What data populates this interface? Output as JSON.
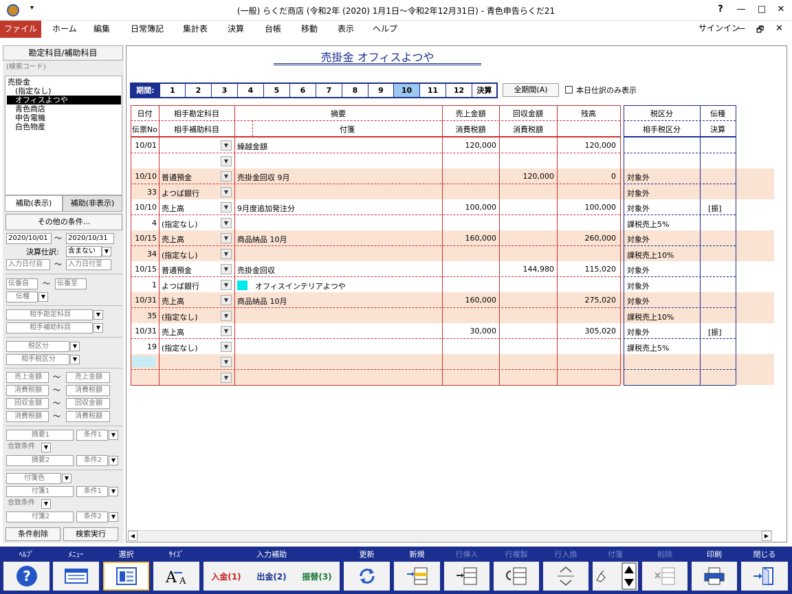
{
  "window": {
    "title": "(一般) らくだ商店 (令和2年 (2020) 1月1日～令和2年12月31日) - 青色申告らくだ21",
    "help": "?",
    "min": "—",
    "max": "□",
    "close": "✕"
  },
  "menu": {
    "items": [
      "ファイル",
      "ホーム",
      "編集",
      "日常簿記",
      "集計表",
      "決算",
      "台帳",
      "移動",
      "表示",
      "ヘルプ"
    ],
    "signin": "サインイン",
    "min": "—",
    "restore": "🗗",
    "close": "✕"
  },
  "left": {
    "header": "勘定科目/補助科目",
    "search_placeholder": "(検索コード)",
    "accounts": [
      "売掛金",
      "(指定なし)",
      "オフィスよつや",
      "青色商店",
      "申告電機",
      "白色物産"
    ],
    "tab_show": "補助(表示)",
    "tab_hide": "補助(非表示)",
    "other_conditions": "その他の条件...",
    "date_from": "2020/10/01",
    "date_to": "2020/10/31",
    "tilde": "～",
    "closing_label": "決算仕訳:",
    "closing_value": "含まない",
    "entry_from": "入力日付自",
    "entry_to": "入力日付至",
    "slip_from": "伝番自",
    "slip_to": "伝番至",
    "slip_type": "伝種",
    "counter_acct": "相手勘定科目",
    "counter_sub": "相手補助科目",
    "tax_cat": "税区分",
    "counter_tax": "相手税区分",
    "sales_amt": "売上金額",
    "tax_amt": "消費税額",
    "collect_amt": "回収金額",
    "summary1": "摘要1",
    "cond1": "条件1",
    "match": "合致条件",
    "summary2": "摘要2",
    "cond2": "条件2",
    "tagcolor": "付箋色",
    "tag1": "付箋1",
    "tag2": "付箋2",
    "clear_btn": "条件削除",
    "search_btn": "検索実行"
  },
  "ledger": {
    "title": "売掛金 オフィスよつや",
    "period_label": "期間:",
    "months": [
      "1",
      "2",
      "3",
      "4",
      "5",
      "6",
      "7",
      "8",
      "9",
      "10",
      "11",
      "12",
      "決算"
    ],
    "selected_month": "10",
    "all_period": "全期間(A)",
    "today_only": "本日仕訳のみ表示",
    "headers": {
      "date": "日付",
      "slipno": "伝票No",
      "acct": "相手勘定科目",
      "subacct": "相手補助科目",
      "summary": "摘要",
      "tag": "付箋",
      "sales": "売上金額",
      "tax1": "消費税額",
      "collect": "回収金額",
      "tax2": "消費税額",
      "balance": "残高",
      "taxcat": "税区分",
      "ctaxcat": "相手税区分",
      "slip": "伝種",
      "closing": "決算"
    },
    "rows": [
      {
        "date": "10/01",
        "no": "",
        "acct": "",
        "sub": "",
        "summary": "繰越金額",
        "tag": "",
        "sales": "120,000",
        "collect": "",
        "balance": "120,000",
        "tax": "",
        "ctax": "",
        "slip": ""
      },
      {
        "date": "10/10",
        "no": "33",
        "acct": "普通預金",
        "sub": "よつば銀行",
        "summary": "売掛金回収 9月",
        "tag": "",
        "sales": "",
        "collect": "120,000",
        "balance": "0",
        "tax": "対象外",
        "ctax": "対象外",
        "slip": ""
      },
      {
        "date": "10/10",
        "no": "4",
        "acct": "売上高",
        "sub": "(指定なし)",
        "summary": "9月度追加発注分",
        "tag": "",
        "sales": "100,000",
        "collect": "",
        "balance": "100,000",
        "tax": "対象外",
        "ctax": "課税売上5%",
        "slip": "[振]"
      },
      {
        "date": "10/15",
        "no": "34",
        "acct": "売上高",
        "sub": "(指定なし)",
        "summary": "商品納品 10月",
        "tag": "",
        "sales": "160,000",
        "collect": "",
        "balance": "260,000",
        "tax": "対象外",
        "ctax": "課税売上10%",
        "slip": ""
      },
      {
        "date": "10/15",
        "no": "1",
        "acct": "普通預金",
        "sub": "よつば銀行",
        "summary": "売掛金回収",
        "tag": "オフィスインテリアよつや",
        "sales": "",
        "collect": "144,980",
        "balance": "115,020",
        "tax": "対象外",
        "ctax": "対象外",
        "slip": ""
      },
      {
        "date": "10/31",
        "no": "35",
        "acct": "売上高",
        "sub": "(指定なし)",
        "summary": "商品納品 10月",
        "tag": "",
        "sales": "160,000",
        "collect": "",
        "balance": "275,020",
        "tax": "対象外",
        "ctax": "課税売上10%",
        "slip": ""
      },
      {
        "date": "10/31",
        "no": "19",
        "acct": "売上高",
        "sub": "(指定なし)",
        "summary": "",
        "tag": "",
        "sales": "30,000",
        "collect": "",
        "balance": "305,020",
        "tax": "対象外",
        "ctax": "課税売上5%",
        "slip": "[振]"
      }
    ]
  },
  "toolbar": {
    "help": "ﾍﾙﾌﾟ",
    "menu": "ﾒﾆｭｰ",
    "select": "選択",
    "size": "ｻｲｽﾞ",
    "input_assist": "入力補助",
    "deposit": "入金(1)",
    "withdraw": "出金(2)",
    "transfer": "振替(3)",
    "update": "更新",
    "new": "新規",
    "row_insert": "行挿入",
    "row_copy": "行複製",
    "row_swap": "行入換",
    "tag": "付箋",
    "delete": "削除",
    "print": "印刷",
    "close": "閉じる"
  },
  "colors": {
    "accent": "#1a2f90",
    "file_menu": "#c0392b",
    "row_alt": "#fbe3d3",
    "selected_month": "#9cc8f0"
  }
}
